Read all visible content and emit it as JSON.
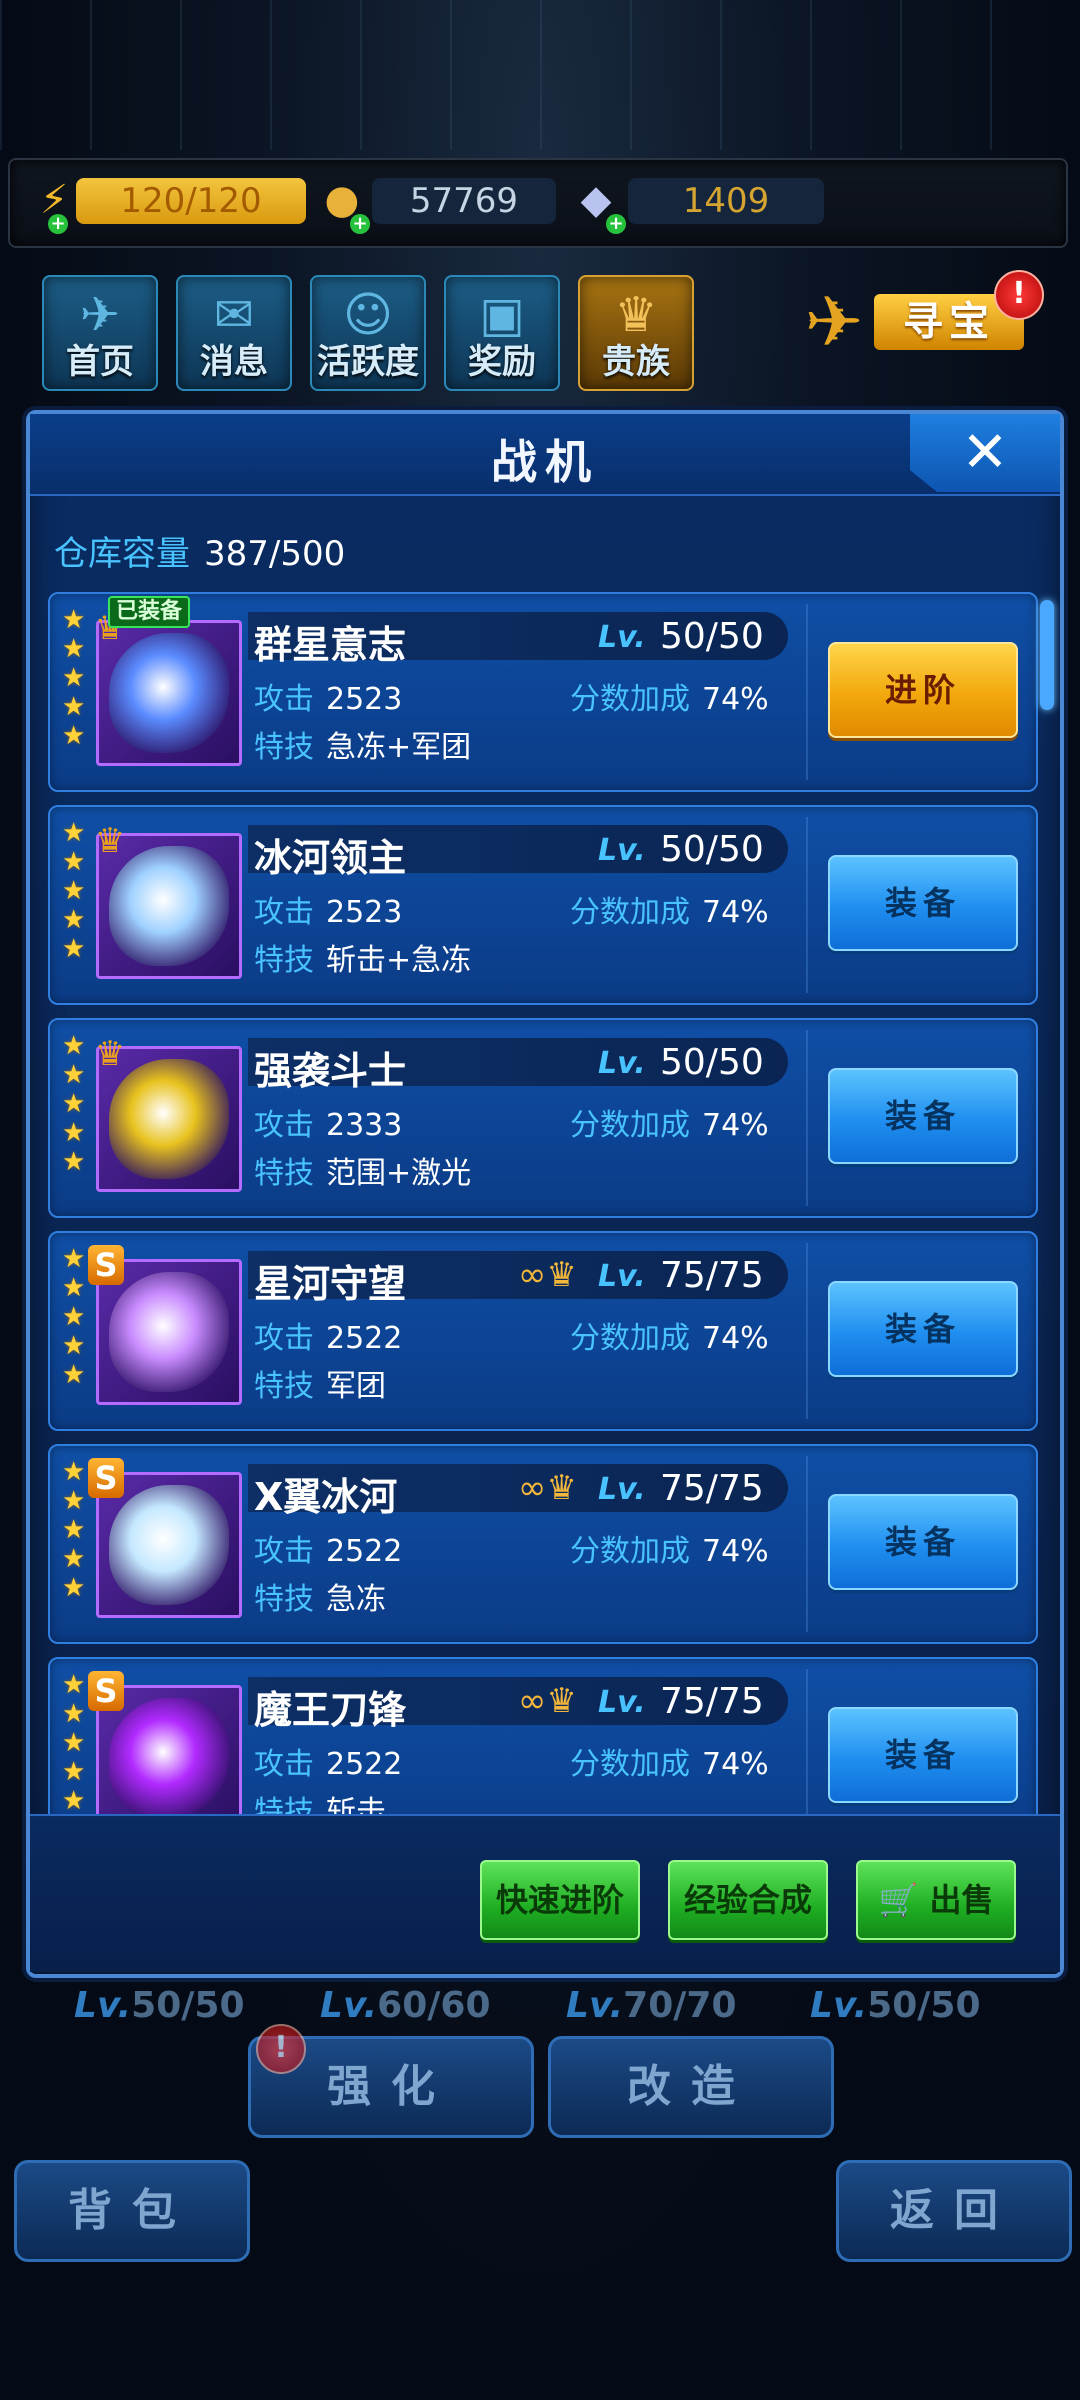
{
  "currency": {
    "energy_icon": "lightning-icon",
    "energy": "120/120",
    "coin_icon": "coin-icon",
    "coins": "57769",
    "gem_icon": "diamond-icon",
    "gems": "1409"
  },
  "nav": {
    "home": "首页",
    "messages": "消息",
    "activity": "活跃度",
    "rewards": "奖励",
    "noble": "贵族",
    "treasure": "寻宝",
    "alert": "!"
  },
  "panel": {
    "title": "战机",
    "close": "✕",
    "capacity_label": "仓库容量",
    "capacity_value": "387/500"
  },
  "fighters": [
    {
      "name": "群星意志",
      "rank": "crown",
      "stars": 5,
      "tag": "已装备",
      "lv_label": "Lv.",
      "lv": "50/50",
      "attack_label": "攻击",
      "attack": "2523",
      "bonus_label": "分数加成",
      "bonus": "74%",
      "skill_label": "特技",
      "skill": "急冻+军团",
      "action": "进阶",
      "color": "#5b8cff"
    },
    {
      "name": "冰河领主",
      "rank": "crown",
      "stars": 5,
      "lv_label": "Lv.",
      "lv": "50/50",
      "attack_label": "攻击",
      "attack": "2523",
      "bonus_label": "分数加成",
      "bonus": "74%",
      "skill_label": "特技",
      "skill": "斩击+急冻",
      "action": "装备",
      "color": "#9fd1ff"
    },
    {
      "name": "强袭斗士",
      "rank": "crown",
      "stars": 5,
      "lv_label": "Lv.",
      "lv": "50/50",
      "attack_label": "攻击",
      "attack": "2333",
      "bonus_label": "分数加成",
      "bonus": "74%",
      "skill_label": "特技",
      "skill": "范围+激光",
      "action": "装备",
      "color": "#e8c21e"
    },
    {
      "name": "星河守望",
      "rank": "S",
      "stars": 5,
      "lv_label": "Lv.",
      "lv": "75/75",
      "attack_label": "攻击",
      "attack": "2522",
      "bonus_label": "分数加成",
      "bonus": "74%",
      "skill_label": "特技",
      "skill": "军团",
      "action": "装备",
      "color": "#c98cff"
    },
    {
      "name": "X翼冰河",
      "rank": "S",
      "stars": 5,
      "lv_label": "Lv.",
      "lv": "75/75",
      "attack_label": "攻击",
      "attack": "2522",
      "bonus_label": "分数加成",
      "bonus": "74%",
      "skill_label": "特技",
      "skill": "急冻",
      "action": "装备",
      "color": "#c4e8ff"
    },
    {
      "name": "魔王刀锋",
      "rank": "S",
      "stars": 5,
      "lv_label": "Lv.",
      "lv": "75/75",
      "attack_label": "攻击",
      "attack": "2522",
      "bonus_label": "分数加成",
      "bonus": "74%",
      "skill_label": "特技",
      "skill": "斩击",
      "action": "装备",
      "color": "#b12aff"
    }
  ],
  "bottom_actions": {
    "quick_advance": "快速进阶",
    "exp_merge": "经验合成",
    "sell_icon": "cart-icon",
    "sell": "出售"
  },
  "background_screen": {
    "levels": [
      "50/50",
      "60/60",
      "70/70",
      "50/50"
    ],
    "lv_label": "Lv.",
    "enhance": "强化",
    "modify": "改造",
    "bag": "背包",
    "back": "返回"
  }
}
